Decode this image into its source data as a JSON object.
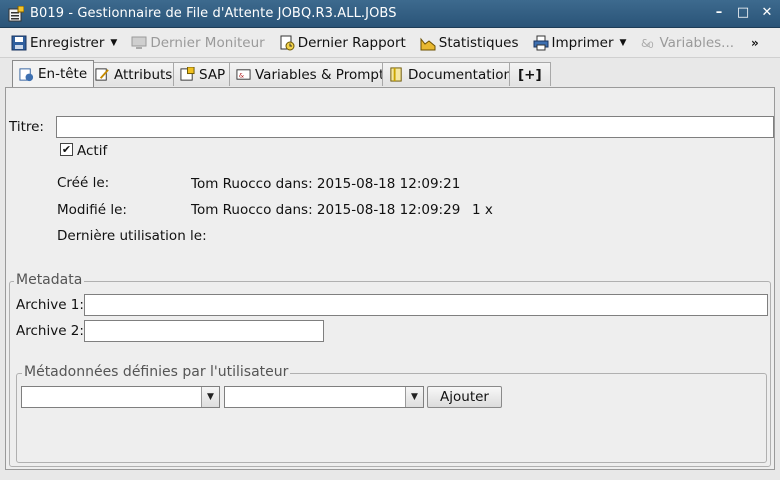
{
  "window": {
    "title": "B019 - Gestionnaire de File d'Attente JOBQ.R3.ALL.JOBS",
    "minimize": "–",
    "maximize": "□",
    "close": "✕"
  },
  "toolbar": {
    "save": "Enregistrer",
    "last_monitor": "Dernier Moniteur",
    "last_report": "Dernier Rapport",
    "statistics": "Statistiques",
    "print": "Imprimer",
    "variables": "Variables...",
    "more": "»"
  },
  "tabs": [
    {
      "label": "En-tête",
      "icon": "header-icon",
      "active": true
    },
    {
      "label": "Attributs",
      "icon": "attributes-icon",
      "active": false
    },
    {
      "label": "SAP",
      "icon": "sap-icon",
      "active": false
    },
    {
      "label": "Variables & Prompts",
      "icon": "variables-icon",
      "active": false
    },
    {
      "label": "Documentation",
      "icon": "documentation-icon",
      "active": false
    },
    {
      "label": "[+]",
      "icon": "add-tab-icon",
      "active": false
    }
  ],
  "header": {
    "title_label": "Titre:",
    "title_value": "",
    "active_label": "Actif",
    "active_checked": true,
    "created_label": "Créé le:",
    "created_value": "Tom Ruocco dans: 2015-08-18 12:09:21",
    "modified_label": "Modifié le:",
    "modified_value": "Tom Ruocco dans: 2015-08-18 12:09:29",
    "modified_count": "1 x",
    "last_used_label": "Dernière utilisation le:",
    "last_used_value": ""
  },
  "metadata": {
    "legend": "Metadata",
    "archive1_label": "Archive 1:",
    "archive1_value": "",
    "archive2_label": "Archive 2:",
    "archive2_value": "",
    "user_legend": "Métadonnées définies par l'utilisateur",
    "combo1_value": "",
    "combo2_value": "",
    "add_button": "Ajouter"
  }
}
